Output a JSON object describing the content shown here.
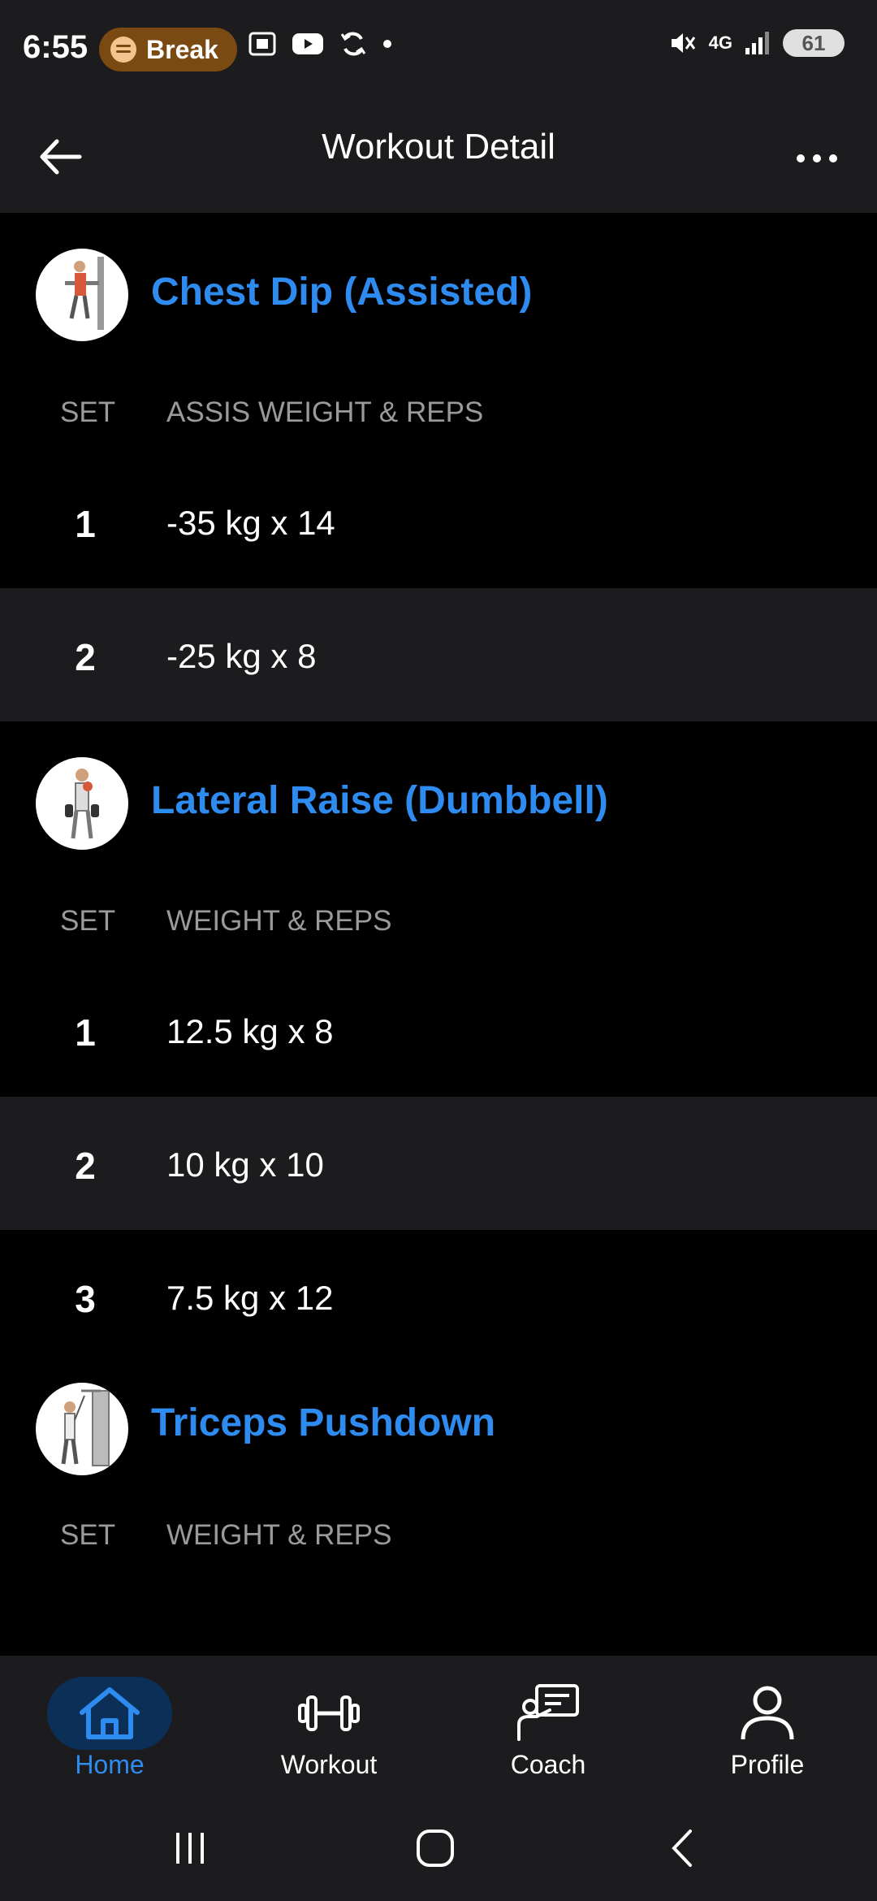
{
  "status_bar": {
    "time": "6:55",
    "media_pill": "Break",
    "battery": "61",
    "network": "4G"
  },
  "app_bar": {
    "title": "Workout Detail"
  },
  "exercises": [
    {
      "name": "Chest Dip (Assisted)",
      "col_set": "SET",
      "col_value": "ASSIS WEIGHT & REPS",
      "sets": [
        {
          "num": "1",
          "value": "-35 kg x 14"
        },
        {
          "num": "2",
          "value": "-25 kg x 8"
        }
      ]
    },
    {
      "name": "Lateral Raise (Dumbbell)",
      "col_set": "SET",
      "col_value": "WEIGHT & REPS",
      "sets": [
        {
          "num": "1",
          "value": "12.5 kg x 8"
        },
        {
          "num": "2",
          "value": "10 kg x 10"
        },
        {
          "num": "3",
          "value": "7.5 kg x 12"
        }
      ]
    },
    {
      "name": "Triceps Pushdown",
      "col_set": "SET",
      "col_value": "WEIGHT & REPS",
      "sets": []
    }
  ],
  "bottom_nav": {
    "items": [
      {
        "label": "Home",
        "icon": "home-icon",
        "active": true
      },
      {
        "label": "Workout",
        "icon": "dumbbell-icon",
        "active": false
      },
      {
        "label": "Coach",
        "icon": "coach-icon",
        "active": false
      },
      {
        "label": "Profile",
        "icon": "profile-icon",
        "active": false
      }
    ]
  },
  "colors": {
    "accent": "#2e8bf0",
    "surface": "#1c1c1e",
    "background": "#000000",
    "muted": "#9a9a9a"
  }
}
